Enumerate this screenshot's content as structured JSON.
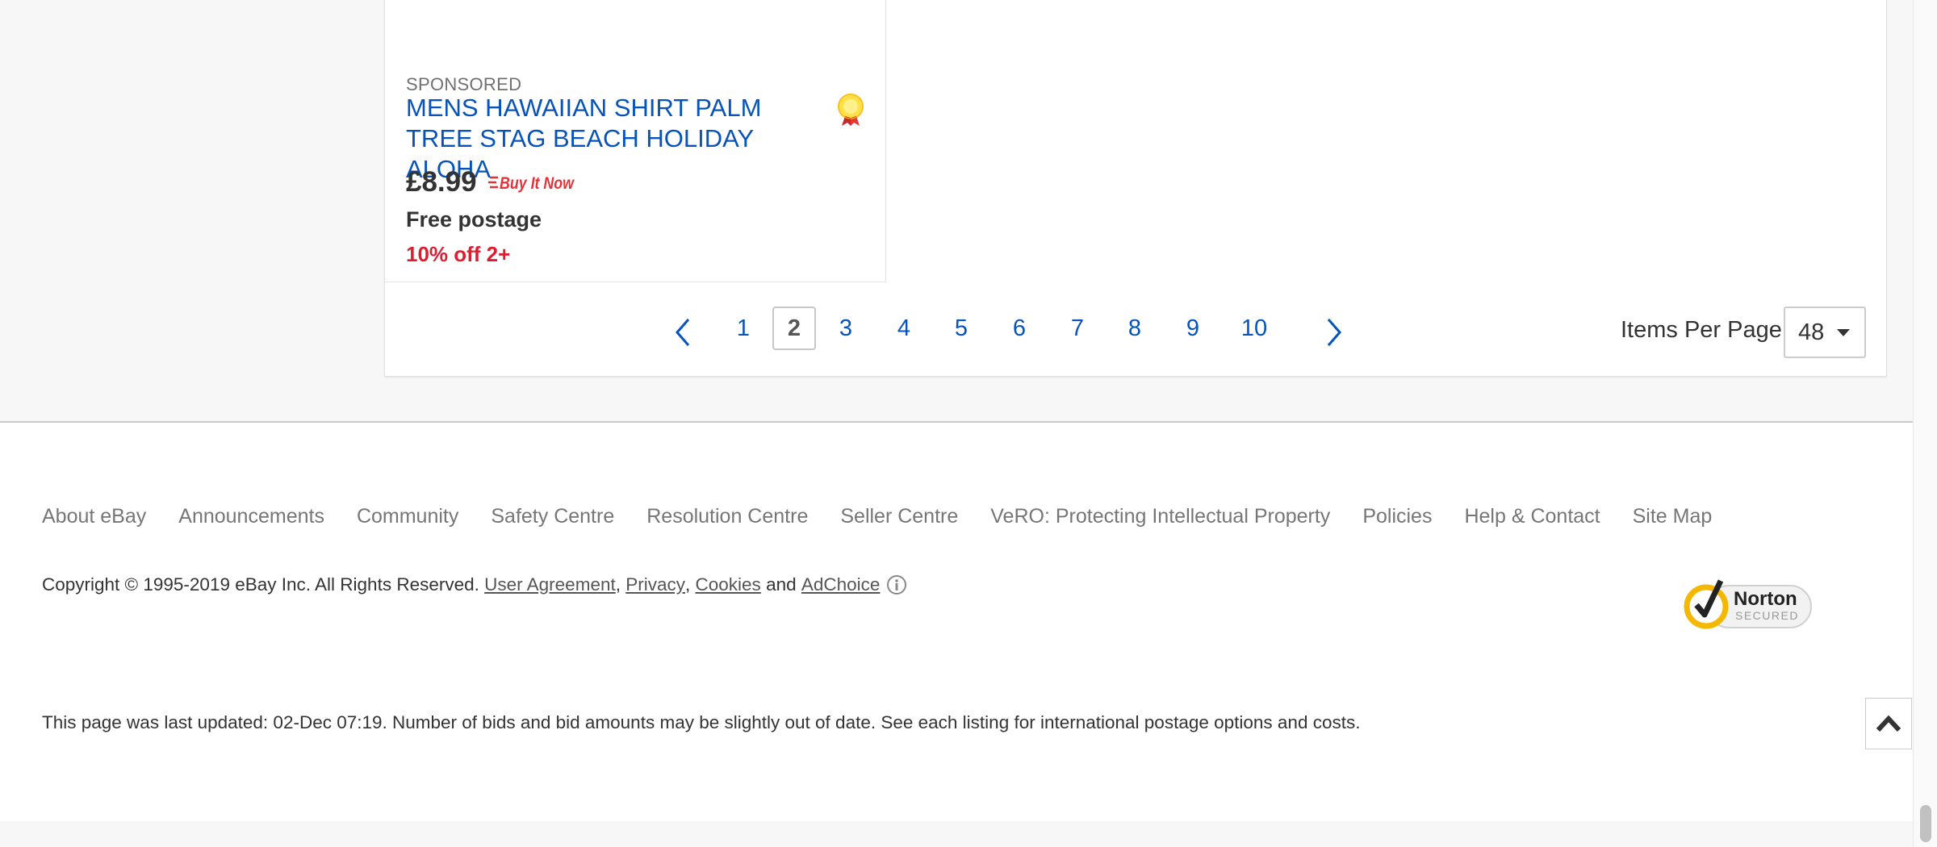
{
  "listing": {
    "sponsored": "SPONSORED",
    "title": "MENS HAWAIIAN SHIRT PALM TREE STAG BEACH HOLIDAY ALOHA",
    "price": "£8.99",
    "buy_it_now": "Buy It Now",
    "postage": "Free postage",
    "discount": "10% off 2+",
    "badge_icon": "top-rated-seller-badge-icon"
  },
  "pagination": {
    "pages": [
      "1",
      "2",
      "3",
      "4",
      "5",
      "6",
      "7",
      "8",
      "9",
      "10"
    ],
    "current": "2",
    "items_per_page_label": "Items Per Page",
    "items_per_page_value": "48"
  },
  "footer": {
    "links": [
      "About eBay",
      "Announcements",
      "Community",
      "Safety Centre",
      "Resolution Centre",
      "Seller Centre",
      "VeRO: Protecting Intellectual Property",
      "Policies",
      "Help & Contact",
      "Site Map"
    ],
    "copyright": "Copyright © 1995-2019 eBay Inc. All Rights Reserved.",
    "user_agreement": "User Agreement",
    "privacy": "Privacy",
    "cookies": "Cookies",
    "and": "and",
    "adchoice": "AdChoice",
    "norton_title": "Norton",
    "norton_subtitle": "SECURED",
    "last_updated": "This page was last updated: 02-Dec 07:19. Number of bids and bid amounts may be slightly out of date. See each listing for international postage options and costs."
  },
  "colors": {
    "link_blue": "#0654ba",
    "discount_red": "#dd1e31",
    "norton_yellow": "#f5b800"
  }
}
